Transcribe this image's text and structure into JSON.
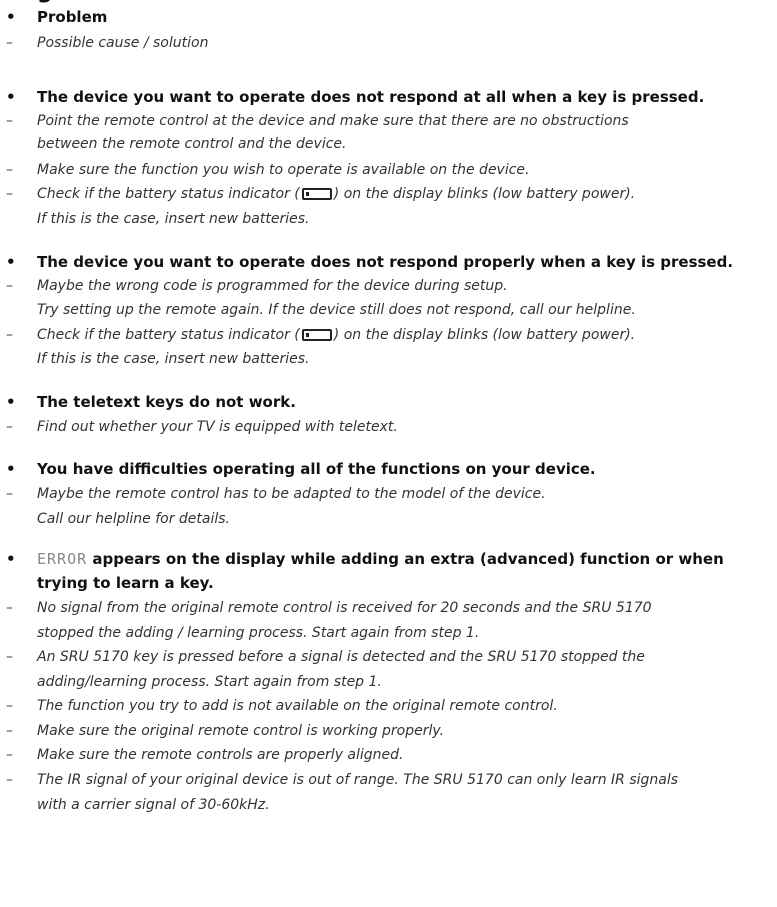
{
  "page": {
    "title_fragment": "g",
    "legend": {
      "problem_label": "Problem",
      "cause_label": "Possible cause / solution"
    },
    "items": [
      {
        "problem": "The device you want to operate does not respond at all when a key is pressed.",
        "causes": [
          [
            "Point the remote control at the device and make sure that there are no obstructions",
            "between the remote control and the device."
          ],
          [
            "Make sure the function you wish to operate is available on the device."
          ],
          [
            "Check if the battery status indicator ([battery]) on the display blinks (low battery power).",
            "If this is the case, insert new batteries."
          ]
        ]
      },
      {
        "problem": "The device you want to operate does not respond properly when a key is pressed.",
        "causes": [
          [
            "Maybe the wrong code is programmed for the device during setup.",
            "Try setting up the remote again. If the device still does not respond, call our helpline."
          ],
          [
            "Check if the battery status indicator ([battery]) on the display blinks (low battery power).",
            "If this is the case, insert new batteries."
          ]
        ]
      },
      {
        "problem": "The teletext keys do not work.",
        "causes": [
          [
            "Find out whether your TV is equipped with teletext."
          ]
        ]
      },
      {
        "problem": "You have difficulties operating all of the functions on your device.",
        "causes": [
          [
            "Maybe the remote control has to be adapted to the model of the device.",
            "Call our helpline for details."
          ]
        ]
      },
      {
        "problem_parts": [
          "ERROR",
          " appears on the display while adding an extra (advanced) function or when",
          "trying to learn a key."
        ],
        "causes": [
          [
            "No signal from the original remote control is received for 20 seconds and the SRU 5170",
            "stopped the adding / learning process. Start again from step 1."
          ],
          [
            "An SRU 5170 key is pressed before a signal is detected and the SRU 5170 stopped the",
            "adding/learning process. Start again from step 1."
          ],
          [
            "The function you try to add is not available on the original remote control."
          ],
          [
            "Make sure the original remote control is working properly."
          ],
          [
            "Make sure the remote controls are properly aligned."
          ],
          [
            "The IR signal of your original device is out of range. The SRU 5170 can only learn IR signals",
            "with a carrier signal of 30-60kHz."
          ]
        ]
      }
    ],
    "battery_icon": "battery-status-icon",
    "bullet": "•",
    "dash": "–"
  }
}
